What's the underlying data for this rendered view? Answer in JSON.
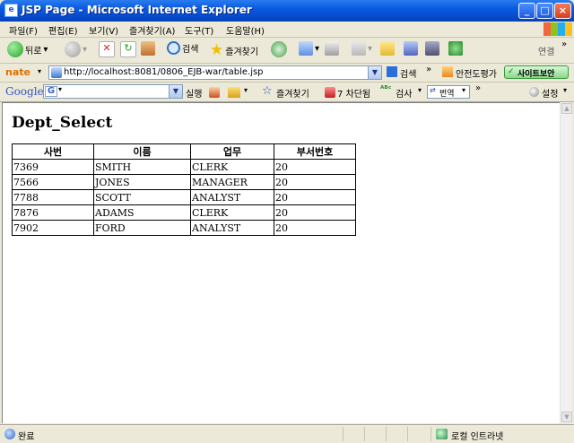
{
  "window": {
    "title": "JSP Page - Microsoft Internet Explorer"
  },
  "menu": [
    {
      "label": "파일(F)"
    },
    {
      "label": "편집(E)"
    },
    {
      "label": "보기(V)"
    },
    {
      "label": "즐겨찾기(A)"
    },
    {
      "label": "도구(T)"
    },
    {
      "label": "도움말(H)"
    }
  ],
  "toolbar": {
    "back_label": "뒤로",
    "search_label": "검색",
    "favorites_label": "즐겨찾기",
    "links_label": "연결"
  },
  "addressbar": {
    "url": "http://localhost:8081/0806_EJB-war/table.jsp",
    "search_label": "검색",
    "safe_label": "안전도평가",
    "site_check_label": "사이트보안"
  },
  "googlebar": {
    "logo": "Google",
    "run_label": "실행",
    "favorites_label": "즐겨찾기",
    "blocked_label": "7 차단됨",
    "check_label": "검사",
    "translate_label": "번역",
    "settings_label": "설정"
  },
  "page": {
    "heading": "Dept_Select",
    "columns": [
      "사번",
      "이름",
      "업무",
      "부서번호"
    ],
    "rows": [
      [
        "7369",
        "SMITH",
        "CLERK",
        "20"
      ],
      [
        "7566",
        "JONES",
        "MANAGER",
        "20"
      ],
      [
        "7788",
        "SCOTT",
        "ANALYST",
        "20"
      ],
      [
        "7876",
        "ADAMS",
        "CLERK",
        "20"
      ],
      [
        "7902",
        "FORD",
        "ANALYST",
        "20"
      ]
    ]
  },
  "status": {
    "left_text": "완료",
    "zone_text": "로컬 인트라넷"
  }
}
